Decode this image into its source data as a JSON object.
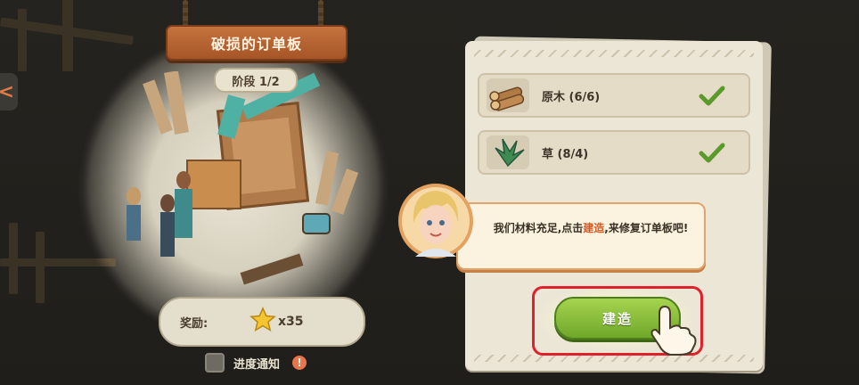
{
  "board": {
    "title": "破损的订单板",
    "stage": "阶段 1/2",
    "reward_label": "奖励:",
    "reward_count": "x35",
    "notify_label": "进度通知",
    "warn_symbol": "!"
  },
  "nav": {
    "left_arrow": "<"
  },
  "resources": [
    {
      "label": "原木 (6/6)",
      "icon": "log-icon",
      "complete": true
    },
    {
      "label": "草 (8/4)",
      "icon": "grass-icon",
      "complete": true
    }
  ],
  "dialog": {
    "text_before": "我们材料充足,点击",
    "text_highlight": "建造",
    "text_after": ",来修复订单板吧!"
  },
  "build_button": {
    "label": "建造"
  },
  "colors": {
    "accent_orange": "#c5733e",
    "button_green": "#8cc43c",
    "highlight_red": "#e0202a",
    "check_green": "#5a9a2a"
  }
}
